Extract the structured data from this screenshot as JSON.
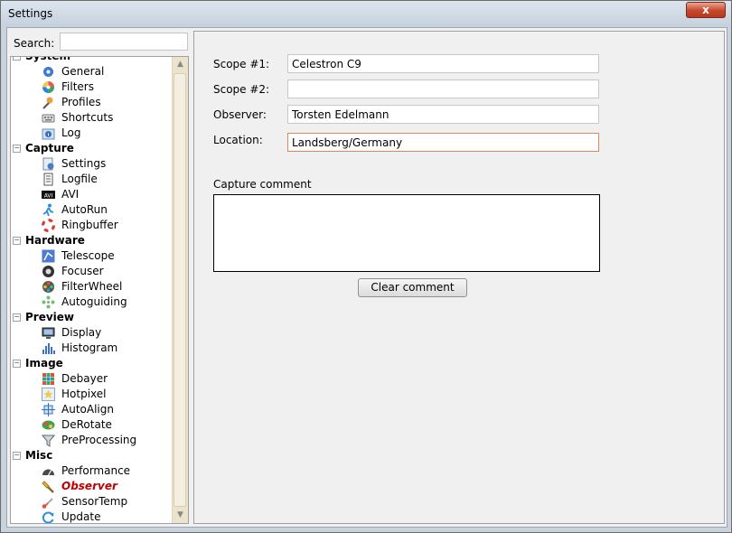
{
  "window": {
    "title": "Settings",
    "close_label": "x"
  },
  "search": {
    "label": "Search:",
    "value": "",
    "placeholder": ""
  },
  "tree": [
    {
      "category": "System",
      "items": [
        {
          "label": "General",
          "icon": "gear-icon"
        },
        {
          "label": "Filters",
          "icon": "color-wheel-icon"
        },
        {
          "label": "Profiles",
          "icon": "profiles-icon"
        },
        {
          "label": "Shortcuts",
          "icon": "keyboard-icon"
        },
        {
          "label": "Log",
          "icon": "info-icon"
        }
      ]
    },
    {
      "category": "Capture",
      "items": [
        {
          "label": "Settings",
          "icon": "capture-settings-icon"
        },
        {
          "label": "Logfile",
          "icon": "logfile-icon"
        },
        {
          "label": "AVI",
          "icon": "avi-icon"
        },
        {
          "label": "AutoRun",
          "icon": "runner-icon"
        },
        {
          "label": "Ringbuffer",
          "icon": "lifebuoy-icon"
        }
      ]
    },
    {
      "category": "Hardware",
      "items": [
        {
          "label": "Telescope",
          "icon": "telescope-icon"
        },
        {
          "label": "Focuser",
          "icon": "focuser-icon"
        },
        {
          "label": "FilterWheel",
          "icon": "filterwheel-icon"
        },
        {
          "label": "Autoguiding",
          "icon": "autoguiding-icon"
        }
      ]
    },
    {
      "category": "Preview",
      "items": [
        {
          "label": "Display",
          "icon": "monitor-icon"
        },
        {
          "label": "Histogram",
          "icon": "histogram-icon"
        }
      ]
    },
    {
      "category": "Image",
      "items": [
        {
          "label": "Debayer",
          "icon": "debayer-grid-icon"
        },
        {
          "label": "Hotpixel",
          "icon": "star-icon"
        },
        {
          "label": "AutoAlign",
          "icon": "align-icon"
        },
        {
          "label": "DeRotate",
          "icon": "rotate-icon"
        },
        {
          "label": "PreProcessing",
          "icon": "funnel-icon"
        }
      ]
    },
    {
      "category": "Misc",
      "items": [
        {
          "label": "Performance",
          "icon": "gauge-icon"
        },
        {
          "label": "Observer",
          "icon": "torch-icon",
          "selected": true
        },
        {
          "label": "SensorTemp",
          "icon": "thermometer-icon"
        },
        {
          "label": "Update",
          "icon": "update-icon"
        }
      ]
    }
  ],
  "form": {
    "scope1": {
      "label": "Scope #1:",
      "value": "Celestron C9"
    },
    "scope2": {
      "label": "Scope #2:",
      "value": ""
    },
    "observer": {
      "label": "Observer:",
      "value": "Torsten Edelmann"
    },
    "location": {
      "label": "Location:",
      "value": "Landsberg/Germany"
    },
    "comment": {
      "label": "Capture comment",
      "value": ""
    },
    "clear_label": "Clear comment"
  },
  "colors": {
    "selected_item": "#c00000",
    "close_button": "#c7462a",
    "focused_border": "#d8895e"
  }
}
